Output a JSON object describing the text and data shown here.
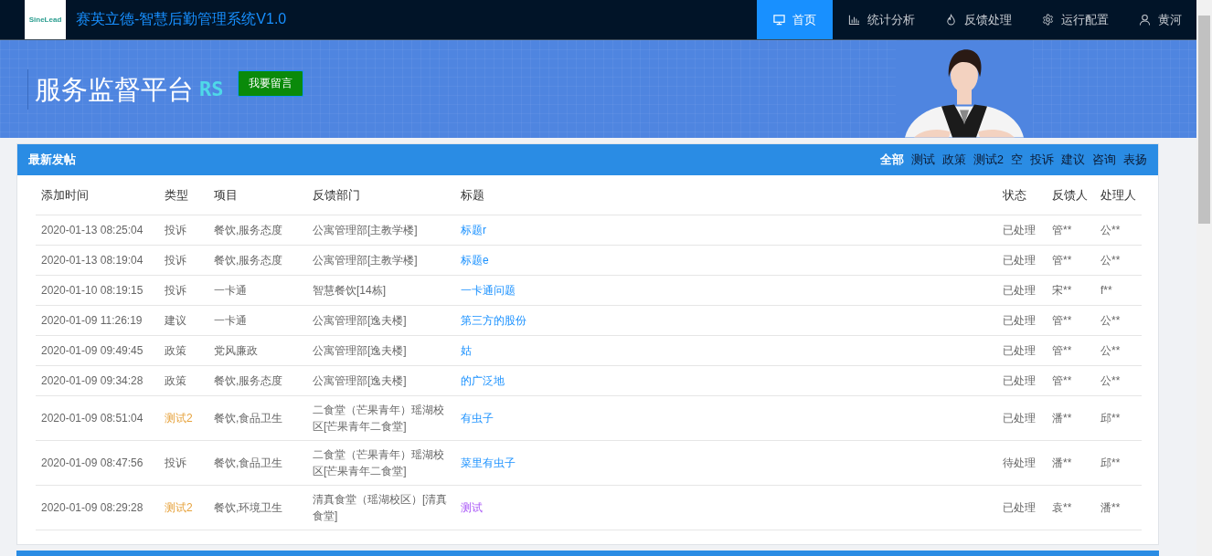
{
  "header": {
    "logo": "SineLead",
    "title": "赛英立德-智慧后勤管理系统V1.0",
    "nav": [
      {
        "label": "首页",
        "selected": true
      },
      {
        "label": "统计分析",
        "selected": false
      },
      {
        "label": "反馈处理",
        "selected": false
      },
      {
        "label": "运行配置",
        "selected": false
      },
      {
        "label": "黄河",
        "selected": false
      }
    ]
  },
  "banner": {
    "title": "服务监督平台",
    "logo_text": "RS",
    "button": "我要留言"
  },
  "panel": {
    "title": "最新发帖",
    "filters": [
      {
        "label": "全部",
        "selected": true
      },
      {
        "label": "测试",
        "selected": false
      },
      {
        "label": "政策",
        "selected": false
      },
      {
        "label": "测试2",
        "selected": false
      },
      {
        "label": "空",
        "selected": false
      },
      {
        "label": "投诉",
        "selected": false
      },
      {
        "label": "建议",
        "selected": false
      },
      {
        "label": "咨询",
        "selected": false
      },
      {
        "label": "表扬",
        "selected": false
      }
    ],
    "table": {
      "columns": [
        "添加时间",
        "类型",
        "项目",
        "反馈部门",
        "标题",
        "状态",
        "反馈人",
        "处理人"
      ],
      "rows": [
        {
          "time": "2020-01-13 08:25:04",
          "type": "投诉",
          "type_highlight": false,
          "project": "餐饮,服务态度",
          "dept": "公寓管理部[主教学楼]",
          "title": "标题r",
          "visited": false,
          "status": "已处理",
          "reporter": "管**",
          "handler": "公**"
        },
        {
          "time": "2020-01-13 08:19:04",
          "type": "投诉",
          "type_highlight": false,
          "project": "餐饮,服务态度",
          "dept": "公寓管理部[主教学楼]",
          "title": "标题e",
          "visited": false,
          "status": "已处理",
          "reporter": "管**",
          "handler": "公**"
        },
        {
          "time": "2020-01-10 08:19:15",
          "type": "投诉",
          "type_highlight": false,
          "project": "一卡通",
          "dept": "智慧餐饮[14栋]",
          "title": "一卡通问题",
          "visited": false,
          "status": "已处理",
          "reporter": "宋**",
          "handler": "f**"
        },
        {
          "time": "2020-01-09 11:26:19",
          "type": "建议",
          "type_highlight": false,
          "project": "一卡通",
          "dept": "公寓管理部[逸夫楼]",
          "title": "第三方的股份",
          "visited": false,
          "status": "已处理",
          "reporter": "管**",
          "handler": "公**"
        },
        {
          "time": "2020-01-09 09:49:45",
          "type": "政策",
          "type_highlight": false,
          "project": "党风廉政",
          "dept": "公寓管理部[逸夫楼]",
          "title": "姑",
          "visited": false,
          "status": "已处理",
          "reporter": "管**",
          "handler": "公**"
        },
        {
          "time": "2020-01-09 09:34:28",
          "type": "政策",
          "type_highlight": false,
          "project": "餐饮,服务态度",
          "dept": "公寓管理部[逸夫楼]",
          "title": "的广泛地",
          "visited": false,
          "status": "已处理",
          "reporter": "管**",
          "handler": "公**"
        },
        {
          "time": "2020-01-09 08:51:04",
          "type": "测试2",
          "type_highlight": true,
          "project": "餐饮,食品卫生",
          "dept": "二食堂（芒果青年）瑶湖校区[芒果青年二食堂]",
          "title": "有虫子",
          "visited": false,
          "status": "已处理",
          "reporter": "潘**",
          "handler": "邱**"
        },
        {
          "time": "2020-01-09 08:47:56",
          "type": "投诉",
          "type_highlight": false,
          "project": "餐饮,食品卫生",
          "dept": "二食堂（芒果青年）瑶湖校区[芒果青年二食堂]",
          "title": "菜里有虫子",
          "visited": false,
          "status": "待处理",
          "reporter": "潘**",
          "handler": "邱**"
        },
        {
          "time": "2020-01-09 08:29:28",
          "type": "测试2",
          "type_highlight": true,
          "project": "餐饮,环境卫生",
          "dept": "清真食堂（瑶湖校区）[清真食堂]",
          "title": "测试",
          "visited": true,
          "status": "已处理",
          "reporter": "袁**",
          "handler": "潘**"
        }
      ]
    }
  }
}
